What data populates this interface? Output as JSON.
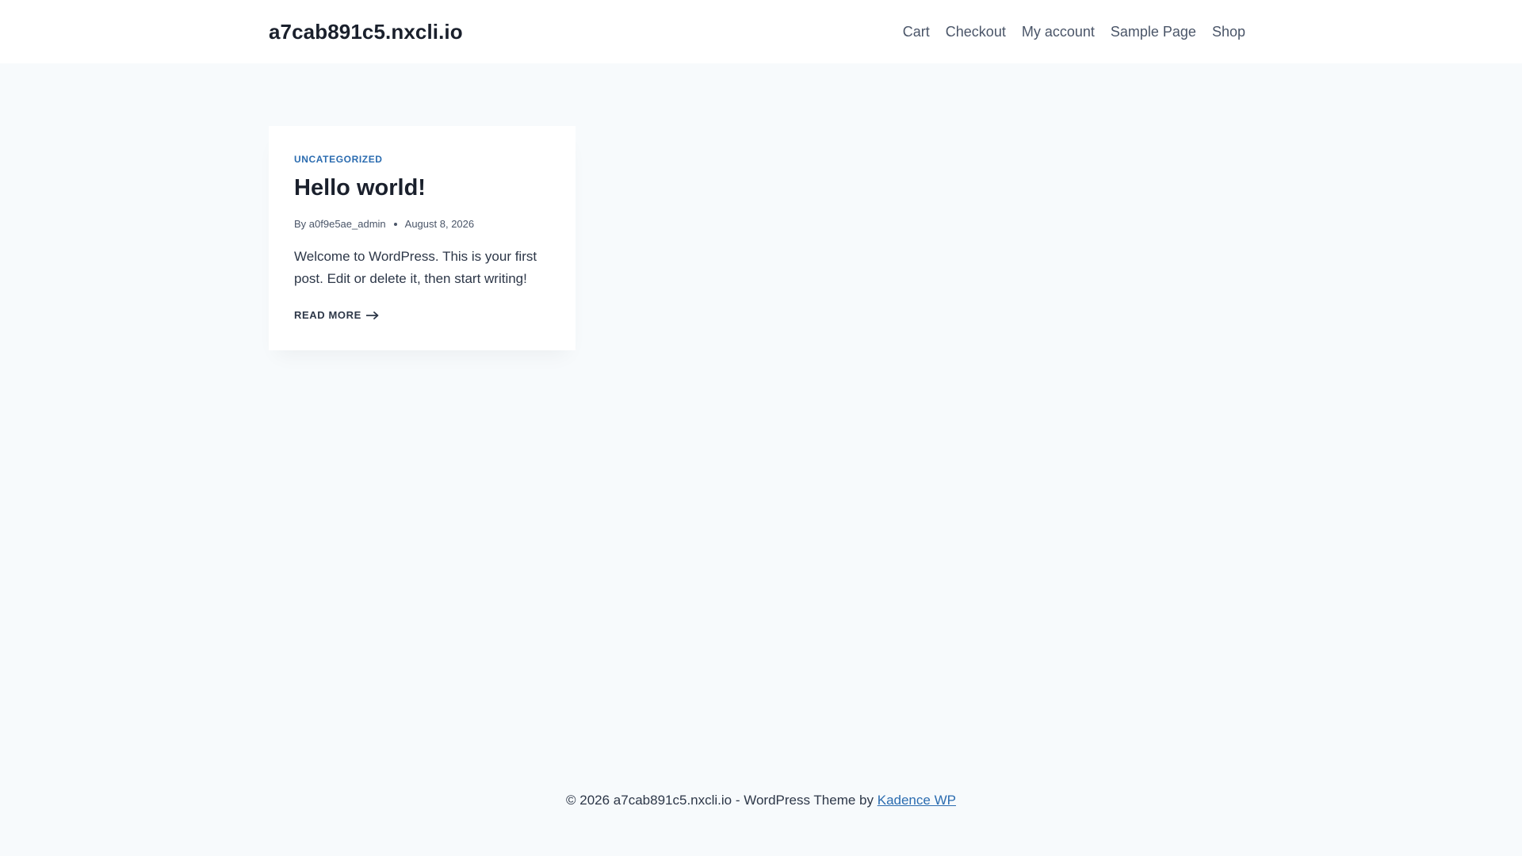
{
  "header": {
    "site_title": "a7cab891c5.nxcli.io",
    "nav": [
      {
        "label": "Cart"
      },
      {
        "label": "Checkout"
      },
      {
        "label": "My account"
      },
      {
        "label": "Sample Page"
      },
      {
        "label": "Shop"
      }
    ]
  },
  "post": {
    "category": "UNCATEGORIZED",
    "title": "Hello world!",
    "by_prefix": "By",
    "author": "a0f9e5ae_admin",
    "date": "August 8, 2026",
    "excerpt": "Welcome to WordPress. This is your first post. Edit or delete it, then start writing!",
    "read_more": "READ MORE",
    "read_more_icon": "arrow-right-icon"
  },
  "footer": {
    "text": "© 2026 a7cab891c5.nxcli.io - WordPress Theme by",
    "link_label": "Kadence WP"
  },
  "colors": {
    "background": "#f7fafc",
    "surface": "#ffffff",
    "accent": "#2b6cb0",
    "heading": "#1a202c",
    "text": "#4a5568"
  }
}
